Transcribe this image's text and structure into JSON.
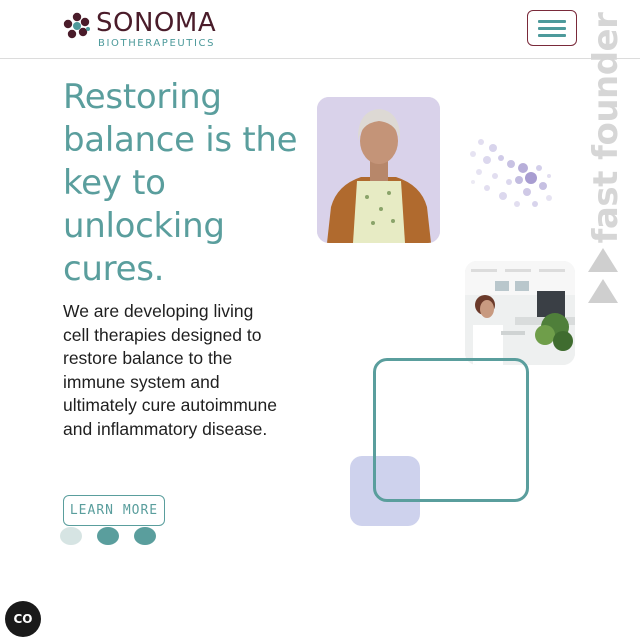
{
  "brand": {
    "name": "SONOMA",
    "tagline": "BIOTHERAPEUTICS"
  },
  "nav": {
    "menu_icon": "hamburger-menu-icon"
  },
  "side_tag": {
    "text": "fast founder",
    "arrow_icons": [
      "triangle-up-icon",
      "triangle-up-icon"
    ]
  },
  "hero": {
    "headline": "Restoring balance is the key to unlocking cures.",
    "body": "We are developing living cell therapies designed to restore balance to the immune system and ultimately cure autoimmune and inflammatory disease.",
    "cta_label": "LEARN MORE"
  },
  "carousel": {
    "dots": 3,
    "active_dot": 1
  },
  "images": [
    "portrait-photo",
    "office-photo"
  ],
  "cookie_button": {
    "label": "CO",
    "icon": "cookie-consent-icon"
  },
  "colors": {
    "teal": "#5a9e9d",
    "burgundy": "#4a1c2a",
    "lavender": "#c9cdeb",
    "light_lavender": "#d9d2ea"
  }
}
